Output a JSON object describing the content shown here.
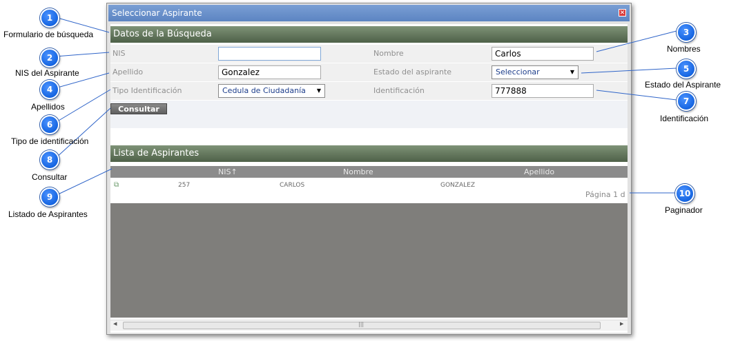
{
  "window": {
    "title": "Seleccionar Aspirante",
    "close_glyph": "✕"
  },
  "search_section": {
    "title": "Datos de la Búsqueda",
    "fields": {
      "nis": {
        "label": "NIS",
        "value": ""
      },
      "nombre": {
        "label": "Nombre",
        "value": "Carlos"
      },
      "apellido": {
        "label": "Apellido",
        "value": "Gonzalez"
      },
      "estado": {
        "label": "Estado del aspirante",
        "value": "Seleccionar"
      },
      "tipo_id": {
        "label": "Tipo Identificación",
        "value": "Cedula de Ciudadanía"
      },
      "identificacion": {
        "label": "Identificación",
        "value": "777888"
      }
    },
    "submit_label": "Consultar"
  },
  "list_section": {
    "title": "Lista de Aspirantes",
    "columns": [
      "NIS↑",
      "Nombre",
      "Apellido"
    ],
    "rows": [
      {
        "nis": "257",
        "nombre": "CARLOS",
        "apellido": "GONZALEZ"
      }
    ],
    "pager": "Página 1 d"
  },
  "callouts": [
    {
      "n": "1",
      "text": "Formulario de búsqueda"
    },
    {
      "n": "2",
      "text": "NIS del Aspirante"
    },
    {
      "n": "3",
      "text": "Nombres"
    },
    {
      "n": "4",
      "text": "Apellidos"
    },
    {
      "n": "5",
      "text": "Estado del Aspirante"
    },
    {
      "n": "6",
      "text": "Tipo de identificación"
    },
    {
      "n": "7",
      "text": "Identificación"
    },
    {
      "n": "8",
      "text": "Consultar"
    },
    {
      "n": "9",
      "text": "Listado de Aspirantes"
    },
    {
      "n": "10",
      "text": "Paginador"
    }
  ],
  "colors": {
    "titlebar": "#5c84c2",
    "section_header": "#5e7358",
    "badge": "#0a62e6",
    "callout_line": "#2d63c8"
  }
}
